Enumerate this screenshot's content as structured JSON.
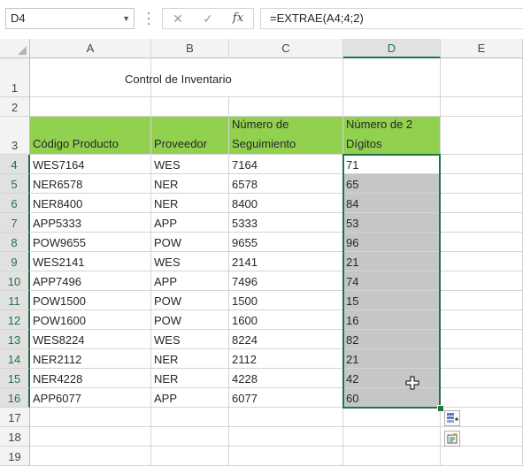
{
  "formula_bar": {
    "name_box": "D4",
    "name_box_caret": "▼",
    "cancel_glyph": "✕",
    "enter_glyph": "✓",
    "fx_label": "fx",
    "formula": "=EXTRAE(A4;4;2)"
  },
  "columns": [
    "A",
    "B",
    "C",
    "D",
    "E"
  ],
  "rows": [
    "1",
    "2",
    "3",
    "4",
    "5",
    "6",
    "7",
    "8",
    "9",
    "10",
    "11",
    "12",
    "13",
    "14",
    "15",
    "16",
    "17",
    "18",
    "19"
  ],
  "sheet": {
    "title": "Control de Inventario",
    "headers": [
      "Código Producto",
      "Proveedor",
      "Número de Seguimiento",
      "Número de 2 Dígitos"
    ],
    "records": [
      [
        "WES7164",
        "WES",
        "7164",
        "71"
      ],
      [
        "NER6578",
        "NER",
        "6578",
        "65"
      ],
      [
        "NER8400",
        "NER",
        "8400",
        "84"
      ],
      [
        "APP5333",
        "APP",
        "5333",
        "53"
      ],
      [
        "POW9655",
        "POW",
        "9655",
        "96"
      ],
      [
        "WES2141",
        "WES",
        "2141",
        "21"
      ],
      [
        "APP7496",
        "APP",
        "7496",
        "74"
      ],
      [
        "POW1500",
        "POW",
        "1500",
        "15"
      ],
      [
        "POW1600",
        "POW",
        "1600",
        "16"
      ],
      [
        "WES8224",
        "WES",
        "8224",
        "82"
      ],
      [
        "NER2112",
        "NER",
        "2112",
        "21"
      ],
      [
        "NER4228",
        "NER",
        "4228",
        "42"
      ],
      [
        "APP6077",
        "APP",
        "6077",
        "60"
      ]
    ]
  },
  "colors": {
    "header_fill": "#92d050",
    "selection_fill": "#c6c6c6",
    "accent": "#217346"
  },
  "icons": [
    "cancel-icon",
    "enter-icon",
    "function-icon",
    "autofill-options-icon",
    "quick-analysis-icon",
    "cross-cursor-icon"
  ]
}
